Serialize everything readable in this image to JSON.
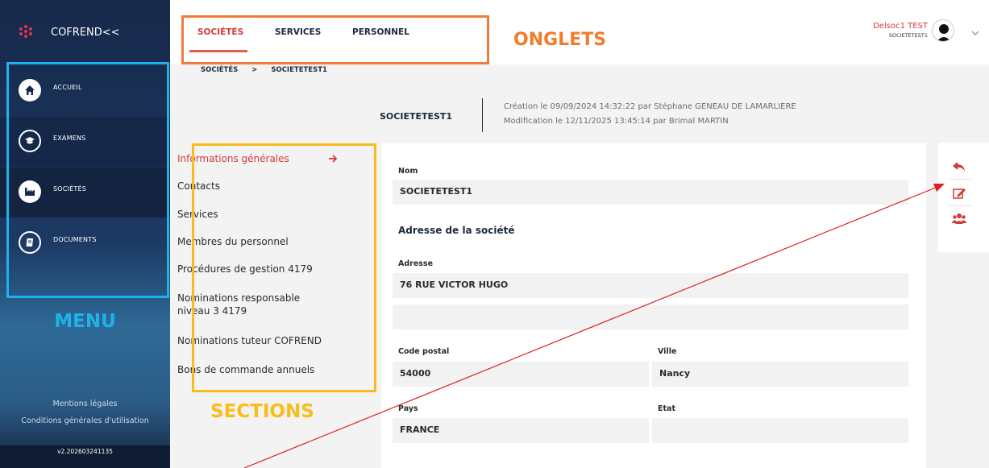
{
  "app": {
    "title": "COFREND<<"
  },
  "sidebar": {
    "items": [
      {
        "label": "ACCUEIL",
        "icon": "home-icon"
      },
      {
        "label": "EXAMENS",
        "icon": "graduation-cap-icon"
      },
      {
        "label": "SOCIÉTÉS",
        "icon": "factory-icon"
      },
      {
        "label": "DOCUMENTS",
        "icon": "book-icon"
      }
    ],
    "footer_links": [
      "Mentions légales",
      "Conditions générales d'utilisation"
    ],
    "version": "v2.202603241135"
  },
  "header": {
    "tabs": [
      {
        "label": "SOCIÉTÉS",
        "active": true
      },
      {
        "label": "SERVICES",
        "active": false
      },
      {
        "label": "PERSONNEL",
        "active": false
      }
    ],
    "user": {
      "name": "Delsoc1 TEST",
      "company": "SOCIETETEST1"
    }
  },
  "breadcrumb": [
    "SOCIÉTÉS",
    ">",
    "SOCIETETEST1"
  ],
  "company": {
    "name": "SOCIETETEST1",
    "created": "Création le 09/09/2024 14:32:22 par Stéphane GENEAU DE LAMARLIERE",
    "modified": "Modification le 12/11/2025 13:45:14 par Brimal MARTIN"
  },
  "sections": [
    {
      "label": "Informations générales",
      "active": true
    },
    {
      "label": "Contacts",
      "active": false
    },
    {
      "label": "Services",
      "active": false
    },
    {
      "label": "Membres du personnel",
      "active": false
    },
    {
      "label": "Procédures de gestion 4179",
      "active": false
    },
    {
      "label": "Nominations responsable niveau 3 4179",
      "active": false
    },
    {
      "label": "Nominations tuteur COFREND",
      "active": false
    },
    {
      "label": "Bons de commande annuels",
      "active": false
    }
  ],
  "form": {
    "nom_label": "Nom",
    "nom_value": "SOCIETETEST1",
    "address_heading": "Adresse de la société",
    "adresse_label": "Adresse",
    "adresse_value": "76 RUE VICTOR HUGO",
    "adresse2_value": "",
    "code_postal_label": "Code postal",
    "code_postal_value": "54000",
    "ville_label": "Ville",
    "ville_value": "Nancy",
    "pays_label": "Pays",
    "pays_value": "FRANCE",
    "etat_label": "Etat",
    "etat_value": ""
  },
  "actions": [
    "back-arrow-icon",
    "edit-icon",
    "users-icon"
  ],
  "annotations": {
    "menu": "MENU",
    "tabs": "ONGLETS",
    "sections": "SECTIONS"
  },
  "colors": {
    "accent_red": "#d33a3a",
    "sidebar_dark": "#17284a",
    "annotation_menu": "#1fb1ea",
    "annotation_tabs": "#ef7c3b",
    "annotation_sections": "#f9bc19"
  }
}
